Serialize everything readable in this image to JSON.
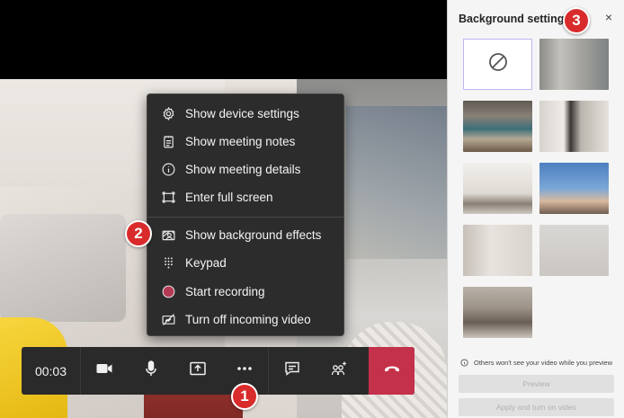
{
  "menu": {
    "items": [
      {
        "label": "Show device settings",
        "icon": "gear-icon"
      },
      {
        "label": "Show meeting notes",
        "icon": "notes-icon"
      },
      {
        "label": "Show meeting details",
        "icon": "info-icon"
      },
      {
        "label": "Enter full screen",
        "icon": "fullscreen-icon"
      },
      {
        "label": "Show background effects",
        "icon": "background-effects-icon"
      },
      {
        "label": "Keypad",
        "icon": "keypad-icon"
      },
      {
        "label": "Start recording",
        "icon": "record-icon"
      },
      {
        "label": "Turn off incoming video",
        "icon": "video-off-icon"
      }
    ]
  },
  "controls": {
    "timer": "00:03",
    "buttons": [
      "camera-icon",
      "microphone-icon",
      "share-screen-icon",
      "more-actions-icon",
      "chat-icon",
      "participants-icon",
      "hang-up-icon"
    ],
    "hangup_color": "#c4314b"
  },
  "callouts": [
    "1",
    "2",
    "3"
  ],
  "panel": {
    "title": "Background settings",
    "close": "×",
    "note": "Others won't see your video while you preview",
    "preview_label": "Preview",
    "apply_label": "Apply and turn on video",
    "accent": "#b9b7f0"
  }
}
